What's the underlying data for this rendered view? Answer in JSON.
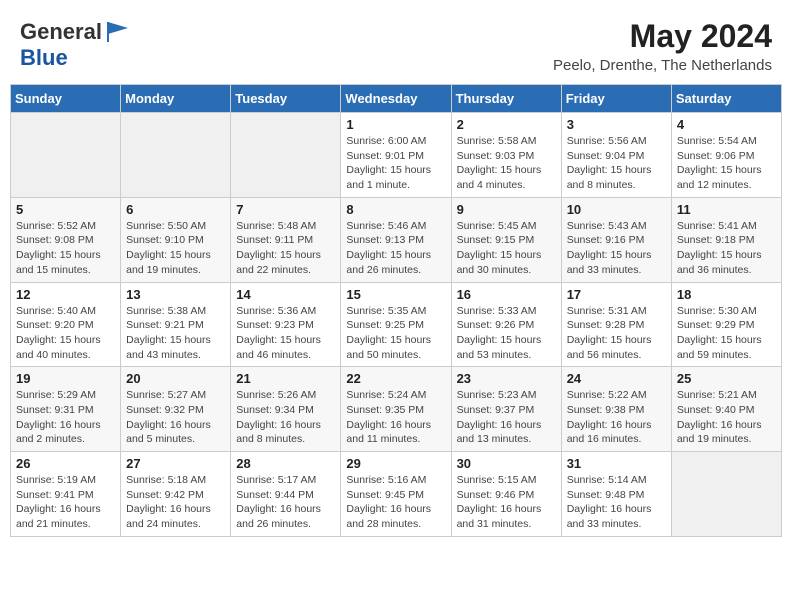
{
  "header": {
    "logo_general": "General",
    "logo_blue": "Blue",
    "month_year": "May 2024",
    "location": "Peelo, Drenthe, The Netherlands"
  },
  "days_of_week": [
    "Sunday",
    "Monday",
    "Tuesday",
    "Wednesday",
    "Thursday",
    "Friday",
    "Saturday"
  ],
  "weeks": [
    [
      {
        "day": "",
        "info": ""
      },
      {
        "day": "",
        "info": ""
      },
      {
        "day": "",
        "info": ""
      },
      {
        "day": "1",
        "info": "Sunrise: 6:00 AM\nSunset: 9:01 PM\nDaylight: 15 hours\nand 1 minute."
      },
      {
        "day": "2",
        "info": "Sunrise: 5:58 AM\nSunset: 9:03 PM\nDaylight: 15 hours\nand 4 minutes."
      },
      {
        "day": "3",
        "info": "Sunrise: 5:56 AM\nSunset: 9:04 PM\nDaylight: 15 hours\nand 8 minutes."
      },
      {
        "day": "4",
        "info": "Sunrise: 5:54 AM\nSunset: 9:06 PM\nDaylight: 15 hours\nand 12 minutes."
      }
    ],
    [
      {
        "day": "5",
        "info": "Sunrise: 5:52 AM\nSunset: 9:08 PM\nDaylight: 15 hours\nand 15 minutes."
      },
      {
        "day": "6",
        "info": "Sunrise: 5:50 AM\nSunset: 9:10 PM\nDaylight: 15 hours\nand 19 minutes."
      },
      {
        "day": "7",
        "info": "Sunrise: 5:48 AM\nSunset: 9:11 PM\nDaylight: 15 hours\nand 22 minutes."
      },
      {
        "day": "8",
        "info": "Sunrise: 5:46 AM\nSunset: 9:13 PM\nDaylight: 15 hours\nand 26 minutes."
      },
      {
        "day": "9",
        "info": "Sunrise: 5:45 AM\nSunset: 9:15 PM\nDaylight: 15 hours\nand 30 minutes."
      },
      {
        "day": "10",
        "info": "Sunrise: 5:43 AM\nSunset: 9:16 PM\nDaylight: 15 hours\nand 33 minutes."
      },
      {
        "day": "11",
        "info": "Sunrise: 5:41 AM\nSunset: 9:18 PM\nDaylight: 15 hours\nand 36 minutes."
      }
    ],
    [
      {
        "day": "12",
        "info": "Sunrise: 5:40 AM\nSunset: 9:20 PM\nDaylight: 15 hours\nand 40 minutes."
      },
      {
        "day": "13",
        "info": "Sunrise: 5:38 AM\nSunset: 9:21 PM\nDaylight: 15 hours\nand 43 minutes."
      },
      {
        "day": "14",
        "info": "Sunrise: 5:36 AM\nSunset: 9:23 PM\nDaylight: 15 hours\nand 46 minutes."
      },
      {
        "day": "15",
        "info": "Sunrise: 5:35 AM\nSunset: 9:25 PM\nDaylight: 15 hours\nand 50 minutes."
      },
      {
        "day": "16",
        "info": "Sunrise: 5:33 AM\nSunset: 9:26 PM\nDaylight: 15 hours\nand 53 minutes."
      },
      {
        "day": "17",
        "info": "Sunrise: 5:31 AM\nSunset: 9:28 PM\nDaylight: 15 hours\nand 56 minutes."
      },
      {
        "day": "18",
        "info": "Sunrise: 5:30 AM\nSunset: 9:29 PM\nDaylight: 15 hours\nand 59 minutes."
      }
    ],
    [
      {
        "day": "19",
        "info": "Sunrise: 5:29 AM\nSunset: 9:31 PM\nDaylight: 16 hours\nand 2 minutes."
      },
      {
        "day": "20",
        "info": "Sunrise: 5:27 AM\nSunset: 9:32 PM\nDaylight: 16 hours\nand 5 minutes."
      },
      {
        "day": "21",
        "info": "Sunrise: 5:26 AM\nSunset: 9:34 PM\nDaylight: 16 hours\nand 8 minutes."
      },
      {
        "day": "22",
        "info": "Sunrise: 5:24 AM\nSunset: 9:35 PM\nDaylight: 16 hours\nand 11 minutes."
      },
      {
        "day": "23",
        "info": "Sunrise: 5:23 AM\nSunset: 9:37 PM\nDaylight: 16 hours\nand 13 minutes."
      },
      {
        "day": "24",
        "info": "Sunrise: 5:22 AM\nSunset: 9:38 PM\nDaylight: 16 hours\nand 16 minutes."
      },
      {
        "day": "25",
        "info": "Sunrise: 5:21 AM\nSunset: 9:40 PM\nDaylight: 16 hours\nand 19 minutes."
      }
    ],
    [
      {
        "day": "26",
        "info": "Sunrise: 5:19 AM\nSunset: 9:41 PM\nDaylight: 16 hours\nand 21 minutes."
      },
      {
        "day": "27",
        "info": "Sunrise: 5:18 AM\nSunset: 9:42 PM\nDaylight: 16 hours\nand 24 minutes."
      },
      {
        "day": "28",
        "info": "Sunrise: 5:17 AM\nSunset: 9:44 PM\nDaylight: 16 hours\nand 26 minutes."
      },
      {
        "day": "29",
        "info": "Sunrise: 5:16 AM\nSunset: 9:45 PM\nDaylight: 16 hours\nand 28 minutes."
      },
      {
        "day": "30",
        "info": "Sunrise: 5:15 AM\nSunset: 9:46 PM\nDaylight: 16 hours\nand 31 minutes."
      },
      {
        "day": "31",
        "info": "Sunrise: 5:14 AM\nSunset: 9:48 PM\nDaylight: 16 hours\nand 33 minutes."
      },
      {
        "day": "",
        "info": ""
      }
    ]
  ]
}
